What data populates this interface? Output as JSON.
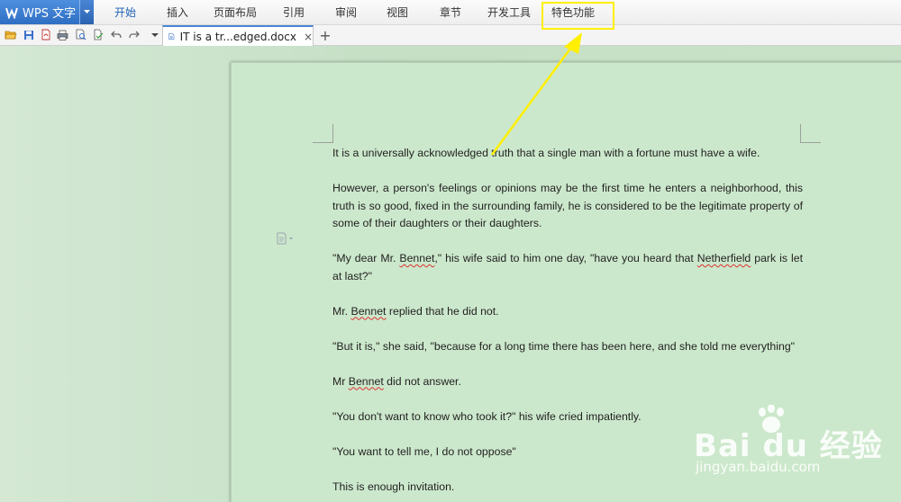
{
  "app": {
    "name": "WPS 文字"
  },
  "menu": {
    "items": [
      {
        "label": "开始",
        "active": true
      },
      {
        "label": "插入"
      },
      {
        "label": "页面布局"
      },
      {
        "label": "引用"
      },
      {
        "label": "审阅"
      },
      {
        "label": "视图"
      },
      {
        "label": "章节"
      },
      {
        "label": "开发工具"
      },
      {
        "label": "特色功能",
        "highlighted": true
      }
    ]
  },
  "toolbar": {
    "icons": [
      "open-folder-icon",
      "save-icon",
      "export-pdf-icon",
      "print-icon",
      "print-preview-icon",
      "spell-check-icon",
      "undo-icon",
      "redo-icon",
      "customize-dropdown-icon"
    ]
  },
  "tabs": [
    {
      "label": "IT is a tr...edged.docx",
      "close": "×"
    }
  ],
  "add_tab": "+",
  "document": {
    "paragraphs": [
      {
        "parts": [
          {
            "text": "It is a universally acknowledged truth that a single man with a fortune must have a wife."
          }
        ]
      },
      {
        "parts": [
          {
            "text": "However, a person's feelings or opinions may be the first time he enters a neighborhood, this truth is so good, fixed in the surrounding family, he is considered to be the legitimate property of some of their daughters or their daughters."
          }
        ]
      },
      {
        "parts": [
          {
            "text": "\"My dear Mr. "
          },
          {
            "text": "Bennet",
            "misspelled": true
          },
          {
            "text": ",\" his wife said to him one day, \"have you heard that "
          },
          {
            "text": "Netherfield",
            "misspelled": true
          },
          {
            "text": " park is let at last?\""
          }
        ]
      },
      {
        "parts": [
          {
            "text": "Mr. "
          },
          {
            "text": "Bennet",
            "misspelled": true
          },
          {
            "text": " replied that he did not."
          }
        ]
      },
      {
        "parts": [
          {
            "text": "\"But it is,\" she said, \"because for a long time there has been here, and she told me everything\""
          }
        ]
      },
      {
        "parts": [
          {
            "text": "Mr "
          },
          {
            "text": "Bennet",
            "misspelled": true
          },
          {
            "text": " did not answer."
          }
        ]
      },
      {
        "parts": [
          {
            "text": "\"You don't want to know who took it?\" his wife cried impatiently."
          }
        ]
      },
      {
        "parts": [
          {
            "text": "\"You want to tell me, I do not oppose\""
          }
        ]
      },
      {
        "parts": [
          {
            "text": "This is enough invitation."
          }
        ]
      }
    ]
  },
  "watermark": {
    "text": "Bai du 经验",
    "sub": "jingyan.baidu.com"
  },
  "colors": {
    "accent": "#2f6fc3",
    "page_background": "#cce8cc",
    "highlight": "#ffef00",
    "spell_error": "#e03030"
  }
}
